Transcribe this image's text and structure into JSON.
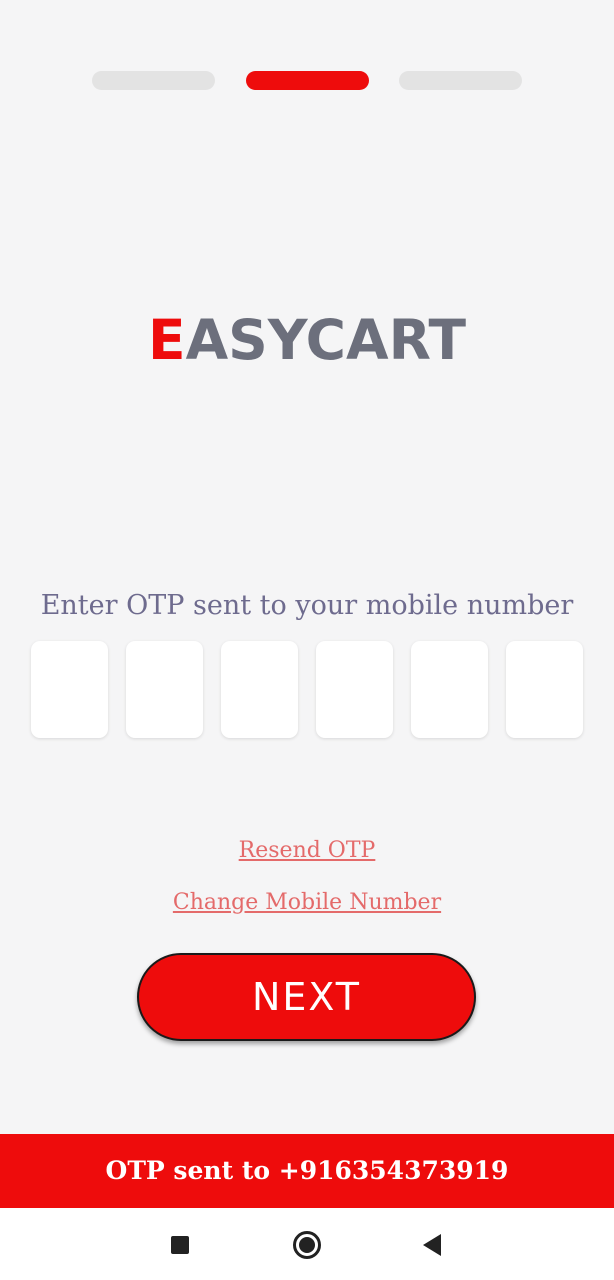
{
  "progress": {
    "total_steps": 3,
    "current_step": 2,
    "active_color": "#ee0c0c",
    "inactive_color": "#e3e3e3"
  },
  "logo": {
    "first_letter": "E",
    "rest": "ASYCART",
    "accent_color": "#ee0c0c",
    "text_color": "#6c6f7c"
  },
  "otp": {
    "label": "Enter OTP sent to your mobile number",
    "digits": [
      "",
      "",
      "",
      "",
      "",
      ""
    ]
  },
  "links": {
    "resend": "Resend OTP",
    "change_number": "Change Mobile Number"
  },
  "next_button": {
    "label": "NEXT"
  },
  "toast": {
    "message": "OTP sent to +916354373919"
  },
  "system_nav": {
    "icons": [
      "recent-apps-icon",
      "home-icon",
      "back-icon"
    ]
  }
}
